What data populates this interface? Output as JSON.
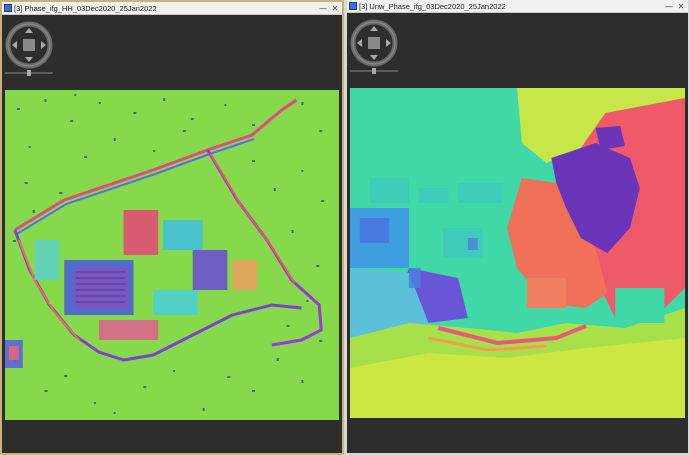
{
  "window_left": {
    "title": "[3] Phase_ifg_HH_03Dec2020_25Jan2022",
    "minimize_label": "—",
    "close_label": "✕"
  },
  "window_right": {
    "title": "[3] Unw_Phase_ifg_03Dec2020_25Jan2022",
    "minimize_label": "—",
    "close_label": "✕"
  },
  "icons": {
    "tab": "image-view-icon",
    "navigation": "pan-zoom-compass-icon"
  },
  "colors": {
    "viewport_bg": "#2d2d2d",
    "wrapped_base": "#86d94a",
    "unwrapped_cyan": "#3fd8a6",
    "unwrapped_yellow": "#c6e64a",
    "unwrapped_red": "#ee5a6a",
    "unwrapped_purple": "#6a35b8",
    "active_border": "#c9b27a"
  }
}
